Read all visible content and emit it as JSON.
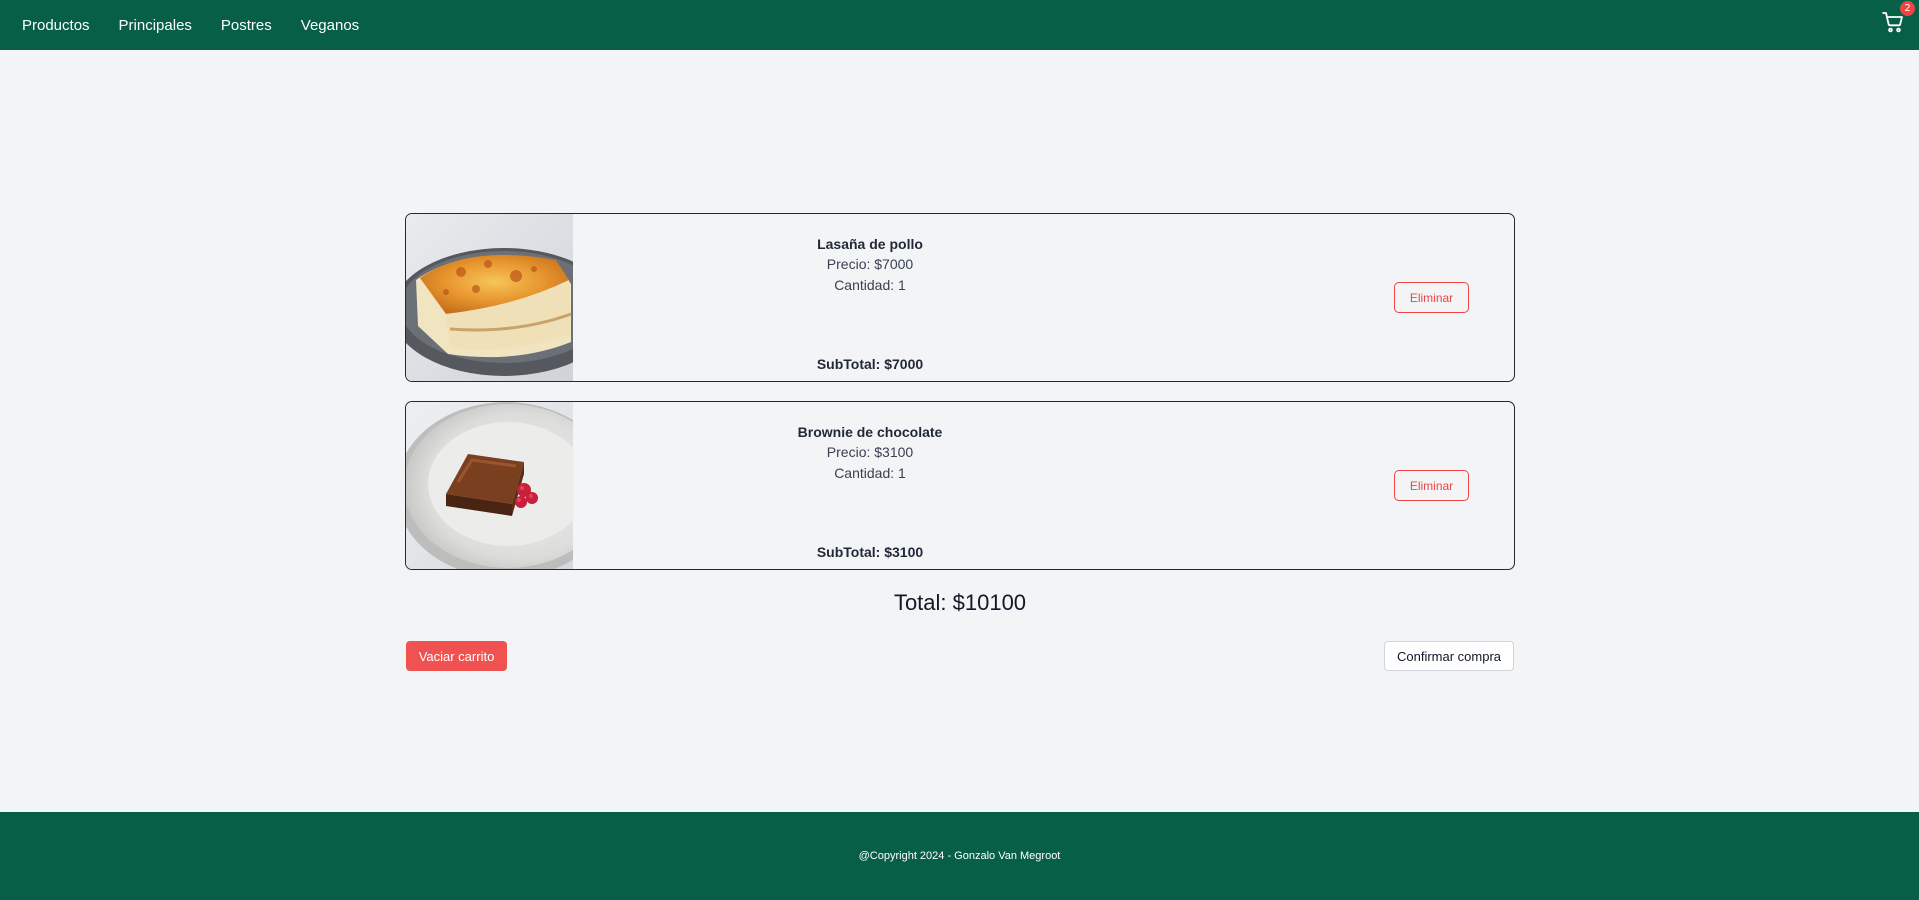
{
  "nav": {
    "links": [
      "Productos",
      "Principales",
      "Postres",
      "Veganos"
    ],
    "cart_icon": "shopping-cart-icon",
    "cart_count": "2"
  },
  "cart": {
    "items": [
      {
        "image": "lasagna-photo",
        "name": "Lasaña de pollo",
        "price": "Precio: $7000",
        "quantity": "Cantidad: 1",
        "subtotal": "SubTotal: $7000",
        "remove_label": "Eliminar"
      },
      {
        "image": "brownie-photo",
        "name": "Brownie de chocolate",
        "price": "Precio: $3100",
        "quantity": "Cantidad: 1",
        "subtotal": "SubTotal: $3100",
        "remove_label": "Eliminar"
      }
    ],
    "total": "Total: $10100",
    "empty_label": "Vaciar carrito",
    "confirm_label": "Confirmar compra"
  },
  "footer": {
    "text": "@Copyright 2024 - Gonzalo Van Megroot"
  },
  "colors": {
    "brand_green": "#065f46",
    "danger_red": "#ef4444",
    "background": "#f3f4f6"
  }
}
